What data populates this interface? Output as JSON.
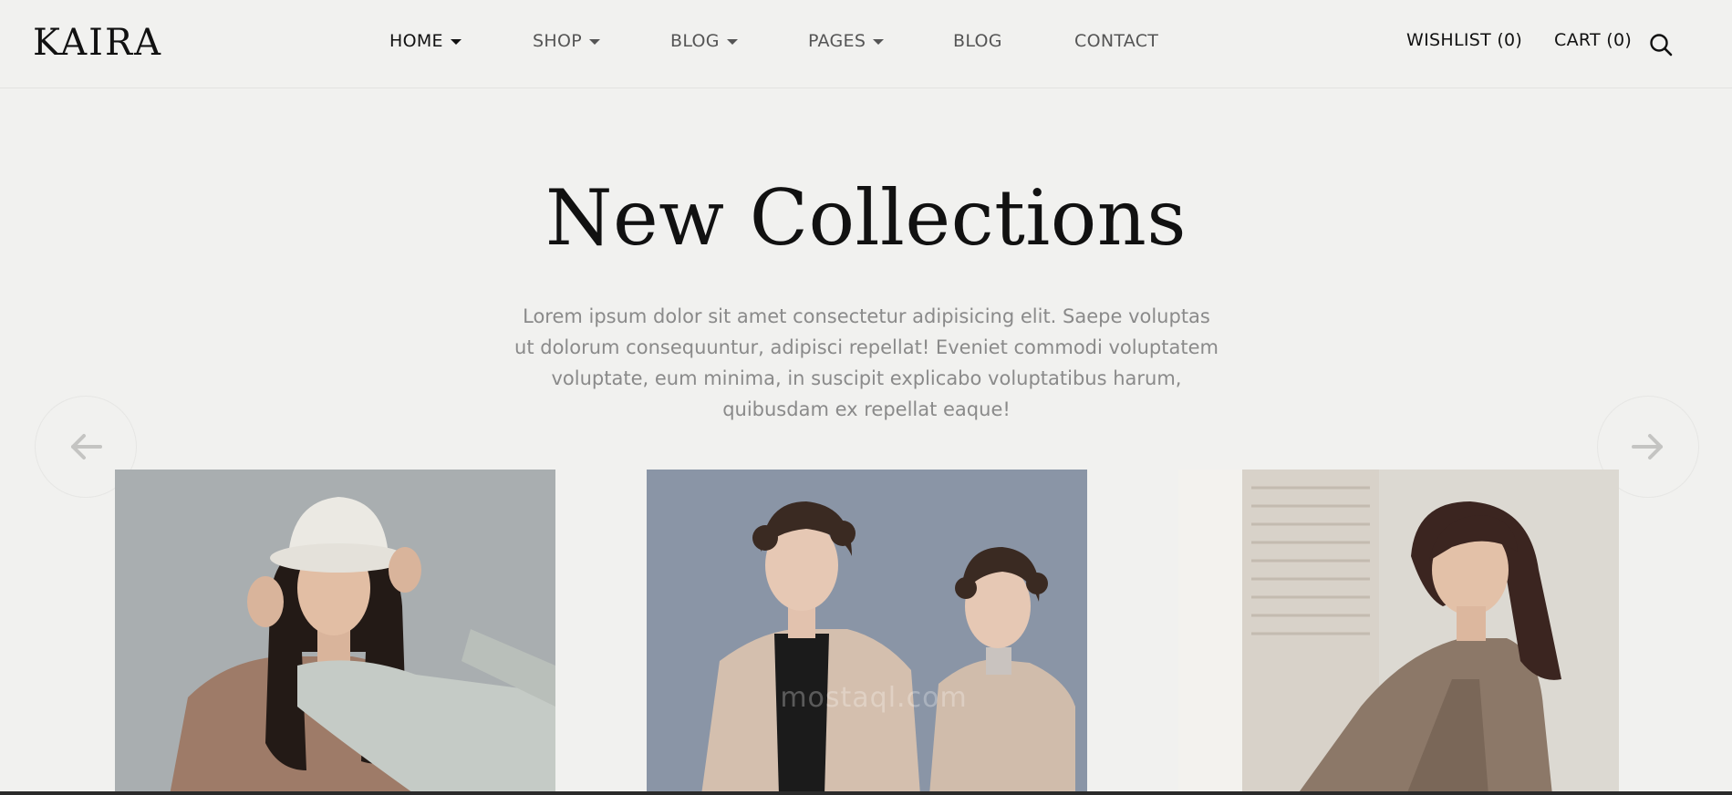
{
  "brand": {
    "logo": "KAIRA"
  },
  "nav": {
    "items": [
      {
        "label": "HOME",
        "dropdown": true,
        "active": true
      },
      {
        "label": "SHOP",
        "dropdown": true,
        "active": false
      },
      {
        "label": "BLOG",
        "dropdown": true,
        "active": false
      },
      {
        "label": "PAGES",
        "dropdown": true,
        "active": false
      },
      {
        "label": "BLOG",
        "dropdown": false,
        "active": false
      },
      {
        "label": "CONTACT",
        "dropdown": false,
        "active": false
      }
    ]
  },
  "utility": {
    "wishlist": "WISHLIST (0)",
    "cart": "CART (0)",
    "search_icon": "search-icon"
  },
  "hero": {
    "title": "New Collections",
    "description": "Lorem ipsum dolor sit amet consectetur adipisicing elit. Saepe voluptas ut dolorum consequuntur, adipisci repellat! Eveniet commodi voluptatem voluptate, eum minima, in suscipit explicabo voluptatibus harum, quibusdam ex repellat eaque!"
  },
  "carousel": {
    "prev_icon": "arrow-left-icon",
    "next_icon": "arrow-right-icon",
    "items": [
      {
        "image": "woman-white-bucket-hat-photo"
      },
      {
        "image": "two-women-beige-coats-photo"
      },
      {
        "image": "woman-plaid-blazer-photo"
      }
    ],
    "watermark": "mostaql.com"
  },
  "colors": {
    "background": "#f1f1ef",
    "text": "#111111",
    "muted_text": "#8a8a8a",
    "nav_text": "#555555"
  }
}
